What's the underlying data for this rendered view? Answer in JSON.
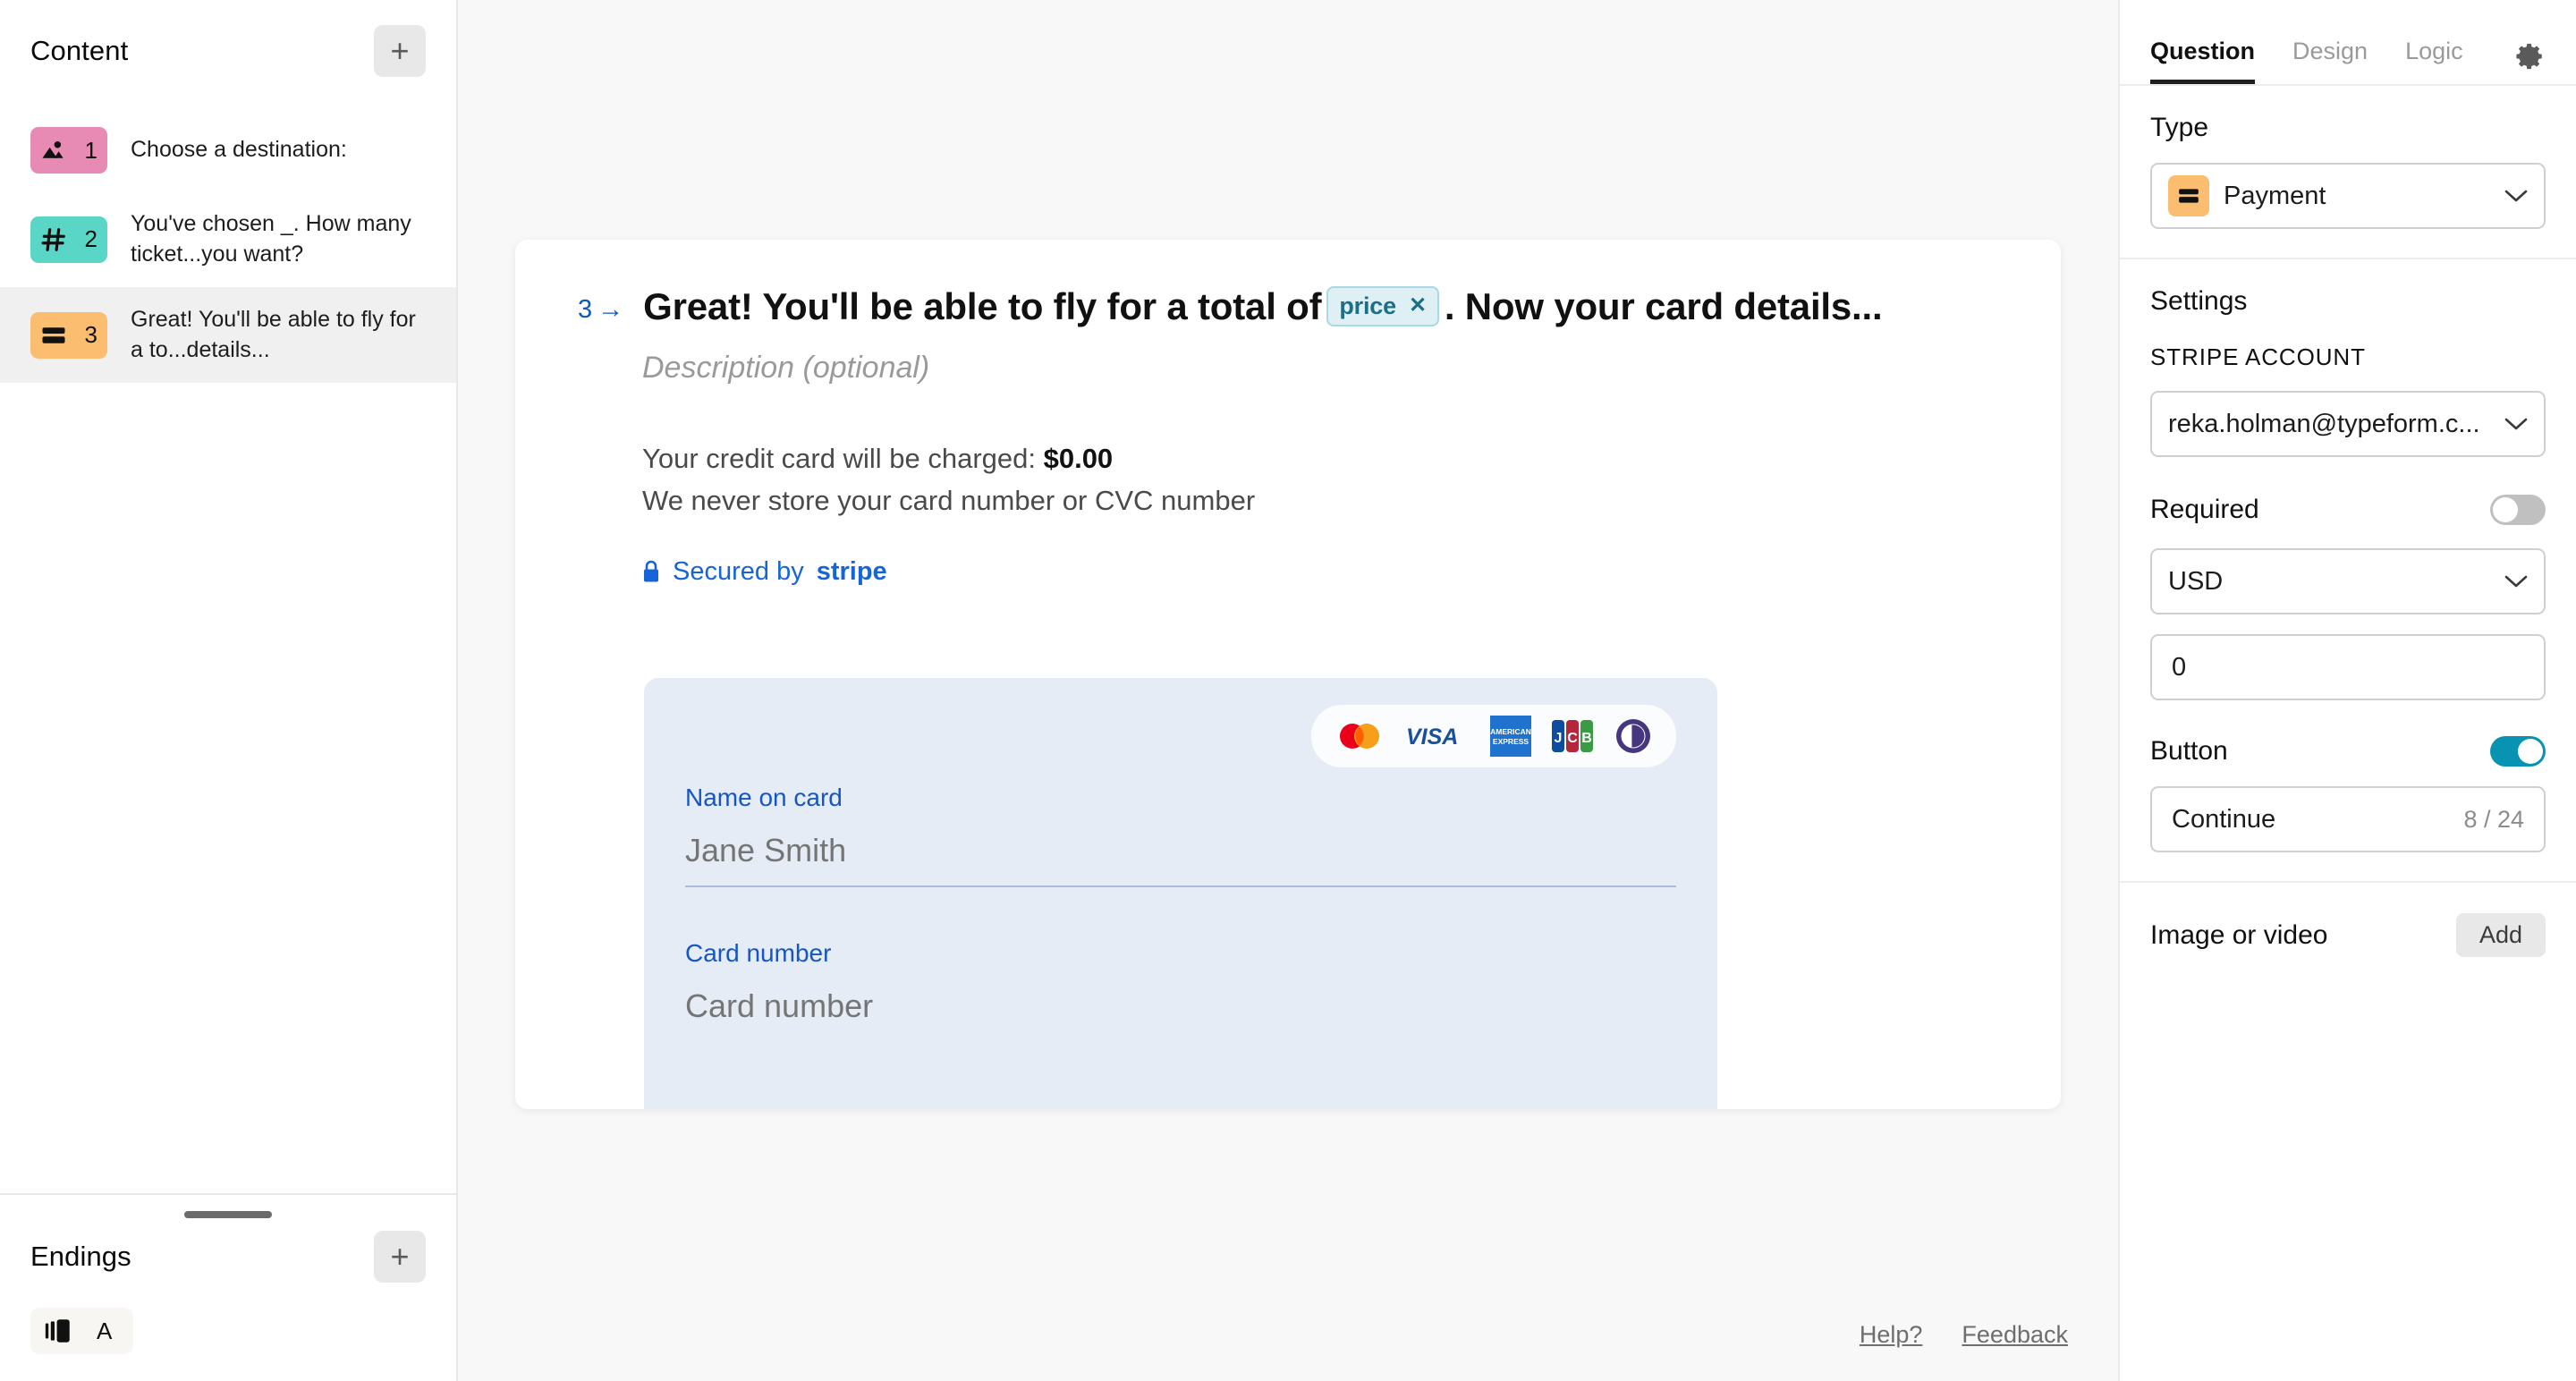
{
  "sidebar": {
    "content_title": "Content",
    "add_label": "+",
    "questions": [
      {
        "num": "1",
        "label": "Choose a destination:",
        "icon": "picture-choice-icon",
        "color": "#e78bb4"
      },
      {
        "num": "2",
        "label": "You've chosen _. How many ticket...you want?",
        "icon": "number-icon",
        "color": "#5ad6c6"
      },
      {
        "num": "3",
        "label": "Great! You'll be able to fly for a to...details...",
        "icon": "payment-card-icon",
        "color": "#fbbd70"
      }
    ],
    "endings_title": "Endings",
    "endings_add_label": "+",
    "endings": [
      {
        "letter": "A",
        "icon": "ending-slide-icon"
      }
    ]
  },
  "canvas": {
    "question_number": "3",
    "question_arrow": "→",
    "title_before": "Great! You'll be able to fly for a total of",
    "chip_label": "price",
    "chip_remove": "✕",
    "title_after": ". Now your card details...",
    "description_placeholder": "Description (optional)",
    "charge_text": "Your credit card will be charged: ",
    "charge_amount": "$0.00",
    "privacy_text": "We never store your card number or CVC number",
    "secured_prefix": "Secured by ",
    "secured_brand": "stripe",
    "card_brands": [
      "mastercard",
      "visa",
      "amex",
      "jcb",
      "diners-club"
    ],
    "name_label": "Name on card",
    "name_placeholder": "Jane Smith",
    "cardnum_label": "Card number",
    "cardnum_placeholder": "Card number",
    "footer": {
      "help": "Help?",
      "feedback": "Feedback"
    }
  },
  "right_panel": {
    "tabs": [
      {
        "label": "Question",
        "active": true
      },
      {
        "label": "Design",
        "active": false
      },
      {
        "label": "Logic",
        "active": false
      }
    ],
    "gear_icon": "gear-icon",
    "type_label": "Type",
    "type_value": "Payment",
    "settings_heading": "Settings",
    "stripe_account_label": "STRIPE ACCOUNT",
    "stripe_account_value": "reka.holman@typeform.c...",
    "required_label": "Required",
    "required_on": false,
    "currency_value": "USD",
    "amount_value": "0",
    "button_label": "Button",
    "button_on": true,
    "button_text": "Continue",
    "button_counter": "8 / 24",
    "image_or_video_label": "Image or video",
    "add_label": "Add"
  },
  "colors": {
    "accent_blue": "#1565d8",
    "toggle_on": "#0893b2",
    "chip_bg": "#dff0f5",
    "chip_border": "#a8d9e4",
    "payform_bg": "#e6ecf5",
    "canvas_bg": "#f8f8f8"
  }
}
